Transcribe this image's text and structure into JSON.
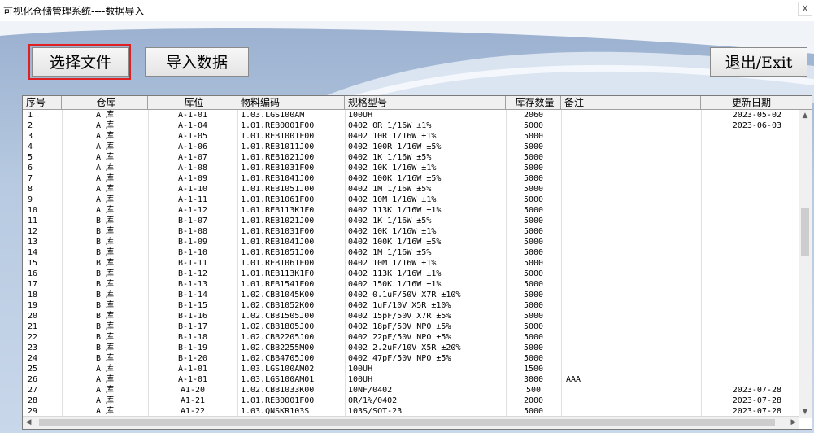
{
  "window": {
    "title": "可视化仓储管理系统----数据导入",
    "close_glyph": "x"
  },
  "toolbar": {
    "select_file": "选择文件",
    "import_data": "导入数据",
    "exit": "退出/Exit"
  },
  "grid": {
    "columns": [
      "序号",
      "仓库",
      "库位",
      "物料编码",
      "规格型号",
      "库存数量",
      "备注",
      "更新日期"
    ],
    "rows": [
      [
        "1",
        "A 库",
        "A-1-01",
        "1.03.LGS100AM",
        "100UH",
        "2060",
        "",
        "2023-05-02"
      ],
      [
        "2",
        "A 库",
        "A-1-04",
        "1.01.REB0001F00",
        "0402 0R 1/16W ±1%",
        "5000",
        "",
        "2023-06-03"
      ],
      [
        "3",
        "A 库",
        "A-1-05",
        "1.01.REB1001F00",
        "0402 10R 1/16W ±1%",
        "5000",
        "",
        ""
      ],
      [
        "4",
        "A 库",
        "A-1-06",
        "1.01.REB1011J00",
        "0402 100R 1/16W ±5%",
        "5000",
        "",
        ""
      ],
      [
        "5",
        "A 库",
        "A-1-07",
        "1.01.REB1021J00",
        "0402 1K 1/16W ±5%",
        "5000",
        "",
        ""
      ],
      [
        "6",
        "A 库",
        "A-1-08",
        "1.01.REB1031F00",
        "0402 10K 1/16W ±1%",
        "5000",
        "",
        ""
      ],
      [
        "7",
        "A 库",
        "A-1-09",
        "1.01.REB1041J00",
        "0402 100K 1/16W ±5%",
        "5000",
        "",
        ""
      ],
      [
        "8",
        "A 库",
        "A-1-10",
        "1.01.REB1051J00",
        "0402 1M 1/16W ±5%",
        "5000",
        "",
        ""
      ],
      [
        "9",
        "A 库",
        "A-1-11",
        "1.01.REB1061F00",
        "0402 10M 1/16W ±1%",
        "5000",
        "",
        ""
      ],
      [
        "10",
        "A 库",
        "A-1-12",
        "1.01.REB113K1F0",
        "0402 113K 1/16W ±1%",
        "5000",
        "",
        ""
      ],
      [
        "11",
        "B 库",
        "B-1-07",
        "1.01.REB1021J00",
        "0402 1K 1/16W ±5%",
        "5000",
        "",
        ""
      ],
      [
        "12",
        "B 库",
        "B-1-08",
        "1.01.REB1031F00",
        "0402 10K 1/16W ±1%",
        "5000",
        "",
        ""
      ],
      [
        "13",
        "B 库",
        "B-1-09",
        "1.01.REB1041J00",
        "0402 100K 1/16W ±5%",
        "5000",
        "",
        ""
      ],
      [
        "14",
        "B 库",
        "B-1-10",
        "1.01.REB1051J00",
        "0402 1M 1/16W ±5%",
        "5000",
        "",
        ""
      ],
      [
        "15",
        "B 库",
        "B-1-11",
        "1.01.REB1061F00",
        "0402 10M 1/16W ±1%",
        "5000",
        "",
        ""
      ],
      [
        "16",
        "B 库",
        "B-1-12",
        "1.01.REB113K1F0",
        "0402 113K 1/16W ±1%",
        "5000",
        "",
        ""
      ],
      [
        "17",
        "B 库",
        "B-1-13",
        "1.01.REB1541F00",
        "0402 150K 1/16W ±1%",
        "5000",
        "",
        ""
      ],
      [
        "18",
        "B 库",
        "B-1-14",
        "1.02.CBB1045K00",
        "0402 0.1uF/50V X7R ±10%",
        "5000",
        "",
        ""
      ],
      [
        "19",
        "B 库",
        "B-1-15",
        "1.02.CBB1052K00",
        "0402 1uF/10V X5R ±10%",
        "5000",
        "",
        ""
      ],
      [
        "20",
        "B 库",
        "B-1-16",
        "1.02.CBB1505J00",
        "0402 15pF/50V X7R ±5%",
        "5000",
        "",
        ""
      ],
      [
        "21",
        "B 库",
        "B-1-17",
        "1.02.CBB1805J00",
        "0402 18pF/50V NPO ±5%",
        "5000",
        "",
        ""
      ],
      [
        "22",
        "B 库",
        "B-1-18",
        "1.02.CBB2205J00",
        "0402 22pF/50V NPO ±5%",
        "5000",
        "",
        ""
      ],
      [
        "23",
        "B 库",
        "B-1-19",
        "1.02.CBB2255M00",
        "0402 2.2uF/10V X5R ±20%",
        "5000",
        "",
        ""
      ],
      [
        "24",
        "B 库",
        "B-1-20",
        "1.02.CBB4705J00",
        "0402 47pF/50V NPO ±5%",
        "5000",
        "",
        ""
      ],
      [
        "25",
        "A 库",
        "A-1-01",
        "1.03.LGS100AM02",
        "100UH",
        "1500",
        "",
        ""
      ],
      [
        "26",
        "A 库",
        "A-1-01",
        "1.03.LGS100AM01",
        "100UH",
        "3000",
        "AAA",
        ""
      ],
      [
        "27",
        "A 库",
        "A1-20",
        "1.02.CBB1033K00",
        "10NF/0402",
        "500",
        "",
        "2023-07-28"
      ],
      [
        "28",
        "A 库",
        "A1-21",
        "1.01.REB0001F00",
        "0R/1%/0402",
        "2000",
        "",
        "2023-07-28"
      ],
      [
        "29",
        "A 库",
        "A1-22",
        "1.03.QNSKR103S",
        "103S/SOT-23",
        "5000",
        "",
        "2023-07-28"
      ]
    ]
  }
}
